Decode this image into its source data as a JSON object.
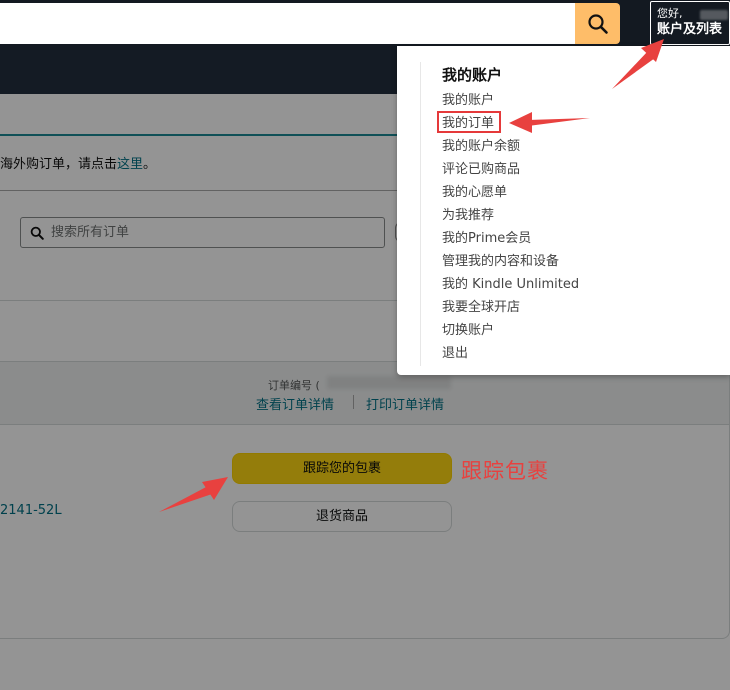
{
  "header": {
    "greeting": "您好,",
    "account_label": "账户及列表",
    "search_icon": "search-icon"
  },
  "main": {
    "notice_prefix": "海外购订单，请点击",
    "notice_link": "这里",
    "notice_suffix": "。",
    "search_placeholder": "搜索所有订单",
    "order_number_label": "订单编号",
    "order_number_paren": "(",
    "view_details": "查看订单详情",
    "print_details": "打印订单详情",
    "item_code": "2141-52L",
    "track_button": "跟踪您的包裹",
    "return_button": "退货商品"
  },
  "flyout": {
    "title": "我的账户",
    "items": [
      "我的账户",
      "我的订单",
      "我的账户余额",
      "评论已购商品",
      "我的心愿单",
      "为我推荐",
      "我的Prime会员",
      "管理我的内容和设备",
      "我的 Kindle Unlimited",
      "我要全球开店",
      "切换账户",
      "退出"
    ],
    "highlighted_index": 1
  },
  "annotations": {
    "track_label": "跟踪包裹",
    "color": "#e8413f"
  }
}
